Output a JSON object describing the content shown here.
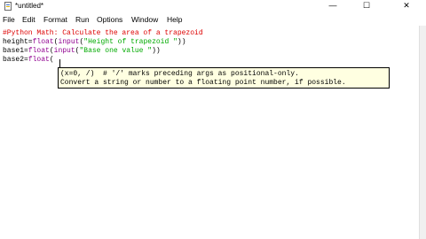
{
  "window": {
    "title": "*untitled*",
    "controls": {
      "minimize": "—",
      "maximize": "☐",
      "close": "✕"
    }
  },
  "menubar": {
    "items": [
      "File",
      "Edit",
      "Format",
      "Run",
      "Options",
      "Window",
      "Help"
    ]
  },
  "editor": {
    "lines": [
      {
        "parts": [
          {
            "text": "#Python Math: Calculate the area of a trapezoid",
            "color": "#dd0000"
          }
        ]
      },
      {
        "parts": [
          {
            "text": "height=",
            "color": "#000000"
          },
          {
            "text": "float",
            "color": "#900090"
          },
          {
            "text": "(",
            "color": "#000000"
          },
          {
            "text": "input",
            "color": "#900090"
          },
          {
            "text": "(",
            "color": "#000000"
          },
          {
            "text": "\"Height of trapezoid \"",
            "color": "#00aa00"
          },
          {
            "text": "))",
            "color": "#000000"
          }
        ]
      },
      {
        "parts": [
          {
            "text": "base1=",
            "color": "#000000"
          },
          {
            "text": "float",
            "color": "#900090"
          },
          {
            "text": "(",
            "color": "#000000"
          },
          {
            "text": "input",
            "color": "#900090"
          },
          {
            "text": "(",
            "color": "#000000"
          },
          {
            "text": "\"Base one value \"",
            "color": "#00aa00"
          },
          {
            "text": "))",
            "color": "#000000"
          }
        ]
      },
      {
        "parts": [
          {
            "text": "base2=",
            "color": "#000000"
          },
          {
            "text": "float",
            "color": "#900090"
          },
          {
            "text": "(",
            "color": "#000000"
          }
        ]
      }
    ]
  },
  "calltip": {
    "line1": "(x=0, /)  # '/' marks preceding args as positional-only.",
    "line2": "Convert a string or number to a floating point number, if possible."
  }
}
